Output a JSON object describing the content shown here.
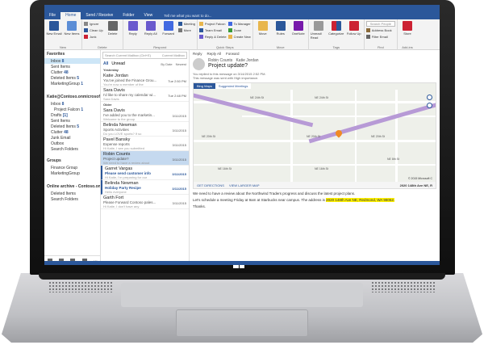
{
  "ribbon": {
    "tabs": [
      "File",
      "Home",
      "Send / Receive",
      "Folder",
      "View"
    ],
    "tell_me": "Tell me what you want to do...",
    "new_email": "New Email",
    "new_items": "New Items",
    "ignore": "Ignore",
    "clean_up": "Clean Up",
    "junk": "Junk",
    "delete": "Delete",
    "reply": "Reply",
    "reply_all": "Reply All",
    "forward": "Forward",
    "meeting": "Meeting",
    "more": "More",
    "project_falcon": "Project Falcon",
    "team_email": "Team Email",
    "reply_delete": "Reply & Delete",
    "to_manager": "To Manager",
    "done": "Done",
    "create_new": "Create New",
    "move": "Move",
    "rules": "Rules",
    "onenote": "OneNote",
    "unread_read": "Unread/ Read",
    "categorize": "Categorize",
    "follow_up": "Follow Up",
    "search_people": "Search People",
    "address_book": "Address Book",
    "filter_email": "Filter Email",
    "store": "Store",
    "group_names": [
      "New",
      "Delete",
      "Respond",
      "Quick Steps",
      "Move",
      "Tags",
      "Find",
      "Add-ins"
    ]
  },
  "nav": {
    "favorites": "Favorites",
    "fav_items": [
      {
        "label": "Inbox",
        "count": "8"
      },
      {
        "label": "Sent Items",
        "count": ""
      },
      {
        "label": "Clutter",
        "count": "48"
      },
      {
        "label": "Deleted Items",
        "count": "5"
      },
      {
        "label": "MarketingGroup",
        "count": "1"
      }
    ],
    "account": "Katie@Contoso.onmicrosoft...",
    "account_items": [
      {
        "label": "Inbox",
        "count": "8"
      },
      {
        "label": "Project Falcon",
        "count": "1"
      },
      {
        "label": "Drafts",
        "count": "[1]"
      },
      {
        "label": "Sent Items",
        "count": ""
      },
      {
        "label": "Deleted Items",
        "count": "5"
      },
      {
        "label": "Clutter",
        "count": "48"
      },
      {
        "label": "Junk Email",
        "count": ""
      },
      {
        "label": "Outbox",
        "count": ""
      },
      {
        "label": "Search Folders",
        "count": ""
      }
    ],
    "groups_header": "Groups",
    "groups": [
      "Finance Group",
      "MarketingGroup"
    ],
    "archive": "Online archive - Contoso.onmi...",
    "archive_items": [
      "Deleted Items",
      "Search Folders"
    ]
  },
  "list": {
    "search_placeholder": "Search Current Mailbox (Ctrl+E)",
    "scope": "Current Mailbox",
    "filter_all": "All",
    "filter_unread": "Unread",
    "sort": "By Date",
    "order": "Newest",
    "group_yesterday": "Yesterday",
    "group_older": "Older",
    "messages": [
      {
        "from": "Katie Jordan",
        "subject": "You've joined the Finance Grou...",
        "preview": "You're now a member of the",
        "date": "Tue 2:50 PM",
        "group": "yesterday"
      },
      {
        "from": "Sara Davis",
        "subject": "I'd like to share my calendar wi...",
        "preview": "Sara Davis",
        "date": "Tue 2:48 PM",
        "group": "yesterday"
      },
      {
        "from": "Sara Davis",
        "subject": "I've added you to the marketin...",
        "preview": "Welcome to the group",
        "date": "3/11/2015",
        "group": "older"
      },
      {
        "from": "Belinda Newman",
        "subject": "Sports Activities",
        "preview": "Do you LOVE sports? If so",
        "date": "3/11/2015",
        "group": "older"
      },
      {
        "from": "Pavel Bansky",
        "subject": "Expense reports",
        "preview": "Hi Katie, I see you submitted",
        "date": "3/11/2015",
        "group": "older"
      },
      {
        "from": "Robin Counts",
        "subject": "Project update?",
        "preview": "We need to have a review about",
        "date": "3/11/2015",
        "group": "older"
      },
      {
        "from": "Garret Vargas",
        "subject": "Please send customer info",
        "preview": "Hi Katie, I'm preparing for our",
        "date": "3/11/2015",
        "group": "older"
      },
      {
        "from": "Belinda Newman",
        "subject": "Holiday Party Recipe",
        "preview": "Hello everyone",
        "date": "3/11/2015",
        "group": "older"
      },
      {
        "from": "Garth Fort",
        "subject": "Please Forward Contoso pales...",
        "preview": "Hi Katie, I don't have any",
        "date": "3/11/2015",
        "group": "older"
      }
    ]
  },
  "reading": {
    "actions": [
      "Reply",
      "Reply All",
      "Forward"
    ],
    "sender": "Robin Counts",
    "recipient": "Katie Jordan",
    "subject": "Project update?",
    "info1": "You replied to this message on 3/14/2015 2:52 PM.",
    "info2": "This message was sent with High importance.",
    "map_tab1": "Bing Maps",
    "map_tab2": "Suggested Meetings",
    "street_labels": [
      "NE 24th St",
      "NE 24th St",
      "NE 20th St",
      "NE 20th St",
      "NE 20th St",
      "NE 16th St",
      "NE 16th St",
      "NE 8th St"
    ],
    "get_directions": "GET DIRECTIONS",
    "view_larger": "VIEW LARGER MAP",
    "map_address": "2020 148th Ave NE, R",
    "copyright": "© 2015 Microsoft C",
    "body1": "We need to have a review about the Northwind Traders progress and discuss the latest project plans.",
    "body2_pre": "Let's schedule a meeting Friday at 9am at Starbucks near campus.  The address is ",
    "body2_addr": "2020 148th Ave NE, Redmond, WA 98052.",
    "body3": "Thanks."
  },
  "colors": {
    "accent": "#2b579a",
    "highlight": "#fff200",
    "pin": "#f08a24",
    "highway": "#b79ad6"
  }
}
